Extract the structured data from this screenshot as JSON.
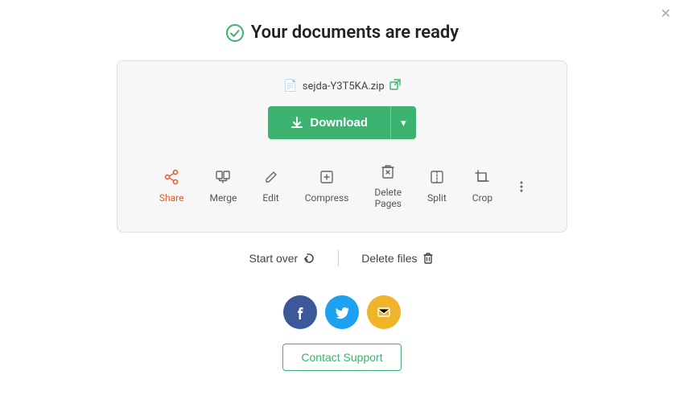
{
  "close": "✕",
  "title": "Your documents are ready",
  "filename": "sejda-Y3T5KA.zip",
  "download_label": "Download",
  "tools": [
    {
      "id": "share",
      "label": "Share",
      "icon": "share"
    },
    {
      "id": "merge",
      "label": "Merge",
      "icon": "merge"
    },
    {
      "id": "edit",
      "label": "Edit",
      "icon": "edit"
    },
    {
      "id": "compress",
      "label": "Compress",
      "icon": "compress"
    },
    {
      "id": "delete-pages",
      "label": "Delete Pages",
      "icon": "delete"
    },
    {
      "id": "split",
      "label": "Split",
      "icon": "split"
    },
    {
      "id": "crop",
      "label": "Crop",
      "icon": "crop"
    }
  ],
  "start_over": "Start over",
  "delete_files": "Delete files",
  "contact_support": "Contact Support",
  "social": {
    "facebook": "f",
    "twitter": "t",
    "email": "✉"
  }
}
